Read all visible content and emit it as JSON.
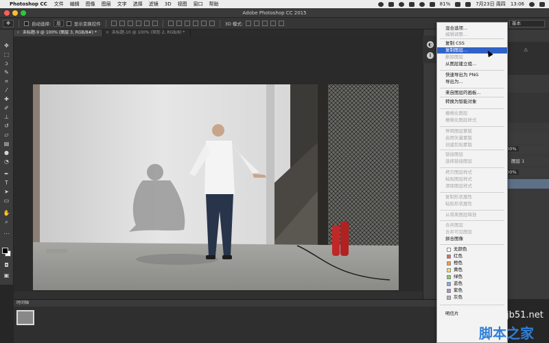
{
  "menubar": {
    "app_name": "Photoshop CC",
    "items": [
      "文件",
      "编辑",
      "图像",
      "图层",
      "文字",
      "选择",
      "滤镜",
      "3D",
      "视图",
      "窗口",
      "帮助"
    ],
    "battery": "81%",
    "date": "7月23日 周四",
    "time": "13:06"
  },
  "window": {
    "title": "Adobe Photoshop CC 2015"
  },
  "options_bar": {
    "auto_select_label": "自动选择:",
    "auto_select_value": "层",
    "show_transform_label": "显示变换控件",
    "mode_label": "3D 模式:",
    "workspace_value": "基本"
  },
  "tabs": [
    {
      "label": "未标题-9 @ 100% (图层 3, RGB/8#) *",
      "active": true
    },
    {
      "label": "未标题-10 @ 100% (矩形 2, RGB/8) *",
      "active": false
    }
  ],
  "timeline": {
    "label": "时间轴"
  },
  "panels": {
    "opacity_value": "100%",
    "fill_value": "100%",
    "layer_label": "图层 1"
  },
  "context_menu": {
    "items": [
      {
        "label": "混合选项...",
        "state": "normal"
      },
      {
        "label": "编辑调整...",
        "state": "disabled"
      },
      {
        "label": "复制 CSS",
        "state": "normal"
      },
      {
        "label": "复制图层...",
        "state": "highlight"
      },
      {
        "label": "删除图层",
        "state": "disabled"
      },
      {
        "label": "从图层建立组...",
        "state": "normal"
      },
      {
        "label": "快速导出为 PNG",
        "state": "normal"
      },
      {
        "label": "导出为...",
        "state": "normal"
      },
      {
        "label": "来自图层的画板...",
        "state": "normal"
      },
      {
        "label": "转换为智能对象",
        "state": "normal"
      },
      {
        "label": "栅格化图层",
        "state": "disabled"
      },
      {
        "label": "栅格化图层样式",
        "state": "disabled"
      },
      {
        "label": "停用图层蒙版",
        "state": "disabled"
      },
      {
        "label": "启用矢量蒙版",
        "state": "disabled"
      },
      {
        "label": "创建剪贴蒙版",
        "state": "disabled"
      },
      {
        "label": "链接图层",
        "state": "disabled"
      },
      {
        "label": "选择链接图层",
        "state": "disabled"
      },
      {
        "label": "拷贝图层样式",
        "state": "disabled"
      },
      {
        "label": "粘贴图层样式",
        "state": "disabled"
      },
      {
        "label": "清除图层样式",
        "state": "disabled"
      },
      {
        "label": "复制形状属性",
        "state": "disabled"
      },
      {
        "label": "粘贴形状属性",
        "state": "disabled"
      },
      {
        "label": "从隔离图层释放",
        "state": "disabled"
      },
      {
        "label": "合并图层",
        "state": "disabled"
      },
      {
        "label": "合并可见图层",
        "state": "disabled"
      },
      {
        "label": "拼合图像",
        "state": "normal"
      },
      {
        "label": "无颜色",
        "state": "normal",
        "swatch": "#ffffff"
      },
      {
        "label": "红色",
        "state": "normal",
        "swatch": "#e06a5c"
      },
      {
        "label": "橙色",
        "state": "normal",
        "swatch": "#f0a048"
      },
      {
        "label": "黄色",
        "state": "normal",
        "swatch": "#f3e163"
      },
      {
        "label": "绿色",
        "state": "normal",
        "swatch": "#7fd06c"
      },
      {
        "label": "蓝色",
        "state": "normal",
        "swatch": "#7aaee6"
      },
      {
        "label": "紫色",
        "state": "normal",
        "swatch": "#b18ad8"
      },
      {
        "label": "灰色",
        "state": "normal",
        "swatch": "#b5b5b5"
      },
      {
        "label": "明信片",
        "state": "normal"
      }
    ]
  },
  "watermark": {
    "site": "jb51.net",
    "brand": "脚本之家"
  },
  "colors": {
    "highlight": "#2f62c8",
    "ui_dark": "#262626",
    "panel": "#3a3a3a"
  }
}
